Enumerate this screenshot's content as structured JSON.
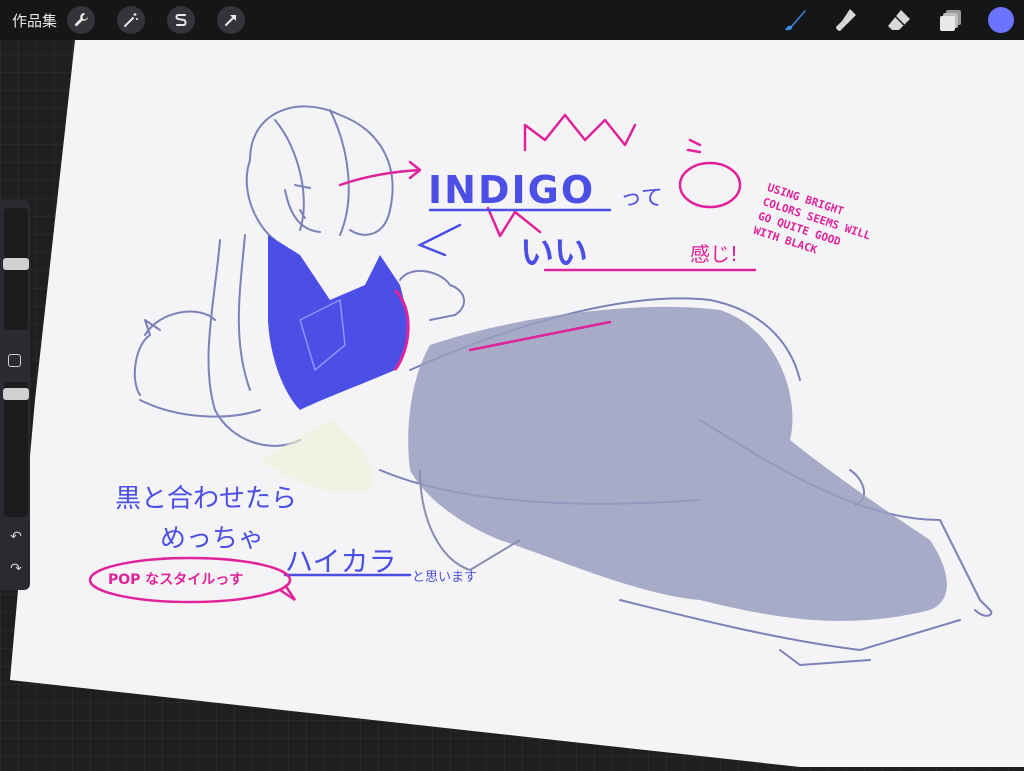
{
  "toolbar": {
    "gallery_label": "作品集",
    "left_tools": [
      {
        "name": "wrench-icon",
        "label": "Actions"
      },
      {
        "name": "magic-wand-icon",
        "label": "Adjustments"
      },
      {
        "name": "selection-s-icon",
        "label": "Selection"
      },
      {
        "name": "arrow-cursor-icon",
        "label": "Transform"
      }
    ],
    "right_tools": [
      {
        "name": "brush-icon"
      },
      {
        "name": "smudge-icon"
      },
      {
        "name": "eraser-icon"
      },
      {
        "name": "layers-icon"
      }
    ],
    "current_color": "#6b73ff"
  },
  "sidebar": {
    "size_slider_level": 0.55,
    "opacity_slider_level": 0.95
  },
  "annotations": {
    "indigo": "INDIGO",
    "tte": "って",
    "word_under": "いい",
    "kanji": "感じ!",
    "english_note_lines": [
      "USING BRIGHT",
      "COLORS SEEMS WILL",
      "GO QUITE GOOD",
      "WITH BLACK"
    ],
    "jp_line1": "黒と合わせたら",
    "jp_line2": "めっちゃ",
    "haikara": "ハイカラ",
    "omoimasu": "と思います",
    "pop_bubble": "POP なスタイルっす"
  },
  "colors": {
    "indigo": "#4b4fe6",
    "magenta": "#e0239a",
    "sketch": "#7c81b8",
    "pants": "#9a9dbf",
    "paper": "#f4f4f6"
  }
}
